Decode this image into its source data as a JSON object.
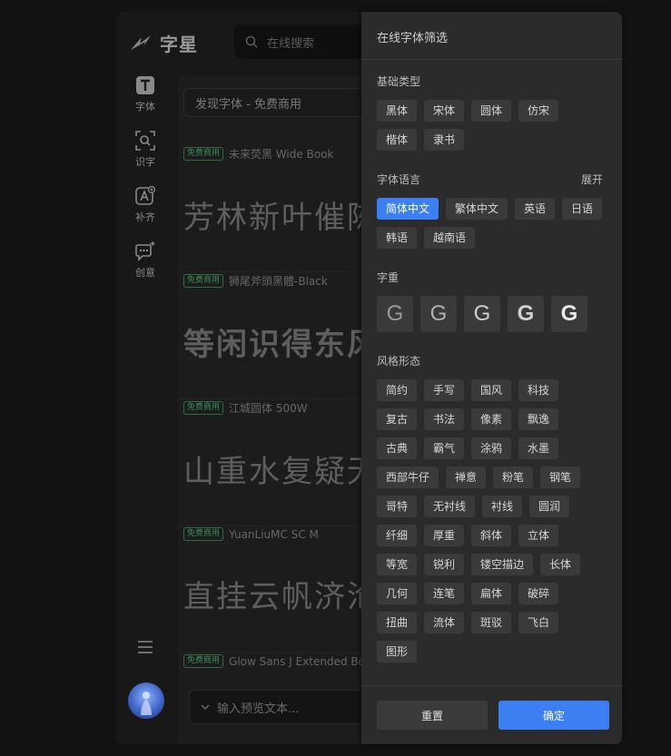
{
  "app": {
    "brand": "字星",
    "search_placeholder": "在线搜索",
    "nav": [
      {
        "label": "字体",
        "icon": "font-t-icon"
      },
      {
        "label": "识字",
        "icon": "scan-search-icon"
      },
      {
        "label": "补齐",
        "icon": "font-add-icon"
      },
      {
        "label": "创意",
        "icon": "creative-chat-icon"
      }
    ],
    "discover": "发现字体 - 免费商用",
    "badge": "免费商用",
    "fonts": [
      {
        "name": "未来荧黑 Wide Book",
        "sample": "芳林新叶催陈"
      },
      {
        "name": "狮尾斧頭黑體-Black",
        "sample": "等闲识得东风"
      },
      {
        "name": "江城圆体 500W",
        "sample": "山重水复疑无"
      },
      {
        "name": "YuanLiuMC SC M",
        "sample": "直挂云帆济沧"
      },
      {
        "name": "Glow Sans J Extended Bold",
        "sample": ""
      }
    ],
    "preview_placeholder": "输入预览文本..."
  },
  "panel": {
    "title": "在线字体筛选",
    "basic": {
      "title": "基础类型",
      "rows": [
        [
          "黑体",
          "宋体",
          "圆体",
          "仿宋"
        ],
        [
          "楷体",
          "隶书"
        ]
      ]
    },
    "language": {
      "title": "字体语言",
      "expand": "展开",
      "active": "简体中文",
      "rows": [
        [
          "简体中文",
          "繁体中文",
          "英语",
          "日语"
        ],
        [
          "韩语",
          "越南语"
        ]
      ]
    },
    "weight": {
      "title": "字重",
      "glyph": "G",
      "weights": [
        100,
        300,
        500,
        700,
        900
      ]
    },
    "style": {
      "title": "风格形态",
      "rows": [
        [
          "简约",
          "手写",
          "国风",
          "科技"
        ],
        [
          "复古",
          "书法",
          "像素",
          "飘逸"
        ],
        [
          "古典",
          "霸气",
          "涂鸦",
          "水墨"
        ],
        [
          "西部牛仔",
          "禅意",
          "粉笔",
          "钢笔"
        ],
        [
          "哥特",
          "无衬线",
          "衬线",
          "圆润"
        ],
        [
          "纤细",
          "厚重",
          "斜体",
          "立体"
        ],
        [
          "等宽",
          "锐利",
          "镂空描边",
          "长体"
        ],
        [
          "几何",
          "连笔",
          "扁体",
          "破碎"
        ],
        [
          "扭曲",
          "流体",
          "斑驳",
          "飞白"
        ],
        [
          "图形"
        ]
      ]
    },
    "reset": "重置",
    "confirm": "确定"
  }
}
